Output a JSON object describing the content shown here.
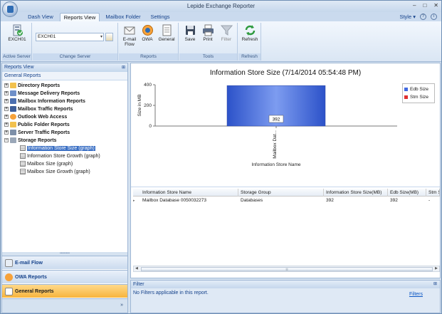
{
  "window": {
    "title": "Lepide Exchange Reporter",
    "controls": [
      "–",
      "□",
      "✕"
    ]
  },
  "tabs": [
    {
      "label": "Dash View",
      "active": false
    },
    {
      "label": "Reports View",
      "active": true
    },
    {
      "label": "Mailbox Folder",
      "active": false
    },
    {
      "label": "Settings",
      "active": false
    }
  ],
  "style_menu": {
    "label": "Style",
    "icons": [
      "help-icon",
      "info-icon"
    ]
  },
  "ribbon": {
    "active_server": {
      "button_label": "EXCH01",
      "group_label": "Active Server"
    },
    "change_server": {
      "combo_value": "EXCH01",
      "group_label": "Change Server"
    },
    "reports": {
      "email_flow_line1": "E-mail",
      "email_flow_line2": "Flow",
      "owa": "OWA",
      "general": "General",
      "group_label": "Reports"
    },
    "tools": {
      "save": "Save",
      "print": "Print",
      "filter": "Filter",
      "group_label": "Tools"
    },
    "refresh": {
      "refresh": "Refresh",
      "group_label": "Refresh"
    }
  },
  "left_panel": {
    "header": "Reports View",
    "subheader": "General Reports",
    "tree": [
      {
        "label": "Directory Reports",
        "expanded": false
      },
      {
        "label": "Message Delivery Reports",
        "expanded": false
      },
      {
        "label": "Mailbox Information Reports",
        "expanded": false
      },
      {
        "label": "Mailbox Traffic Reports",
        "expanded": false
      },
      {
        "label": "Outlook Web Access",
        "expanded": false
      },
      {
        "label": "Public Folder Reports",
        "expanded": false
      },
      {
        "label": "Server Traffic Reports",
        "expanded": false
      },
      {
        "label": "Storage Reports",
        "expanded": true,
        "children": [
          {
            "label": "Information Store Size (graph)",
            "selected": true
          },
          {
            "label": "Information Store Growth (graph)",
            "selected": false
          },
          {
            "label": "Mailbox Size (graph)",
            "selected": false
          },
          {
            "label": "Mailbox Size Growth (graph)",
            "selected": false
          }
        ]
      }
    ],
    "nav_buttons": [
      {
        "label": "E-mail Flow",
        "active": false
      },
      {
        "label": "OWA Reports",
        "active": false
      },
      {
        "label": "General Reports",
        "active": true
      }
    ]
  },
  "chart_data": {
    "type": "bar",
    "title": "Information Store Size (7/14/2014 05:54:48 PM)",
    "xlabel": "Information Store Name",
    "ylabel": "Size in MB",
    "categories": [
      "Mailbox Dat..."
    ],
    "series": [
      {
        "name": "Edb Size",
        "values": [
          392
        ],
        "color": "#4169e1"
      },
      {
        "name": "Stm Size",
        "values": [
          0
        ],
        "color": "#e03030"
      }
    ],
    "data_labels": [
      "392"
    ],
    "yticks": [
      0,
      200,
      400
    ],
    "ylim": [
      0,
      400
    ],
    "grid": false,
    "legend": "right"
  },
  "table": {
    "columns": [
      "Information Store Name",
      "Storage Group",
      "Information Store Size(MB)",
      "Edb Size(MB)",
      "Stm Siz"
    ],
    "rows": [
      [
        "Mailbox Database 0050032273",
        "Databases",
        "392",
        "392",
        "-"
      ]
    ]
  },
  "filter": {
    "header": "Filter",
    "message": "No Filters applicable in this report.",
    "link": "Filters"
  }
}
